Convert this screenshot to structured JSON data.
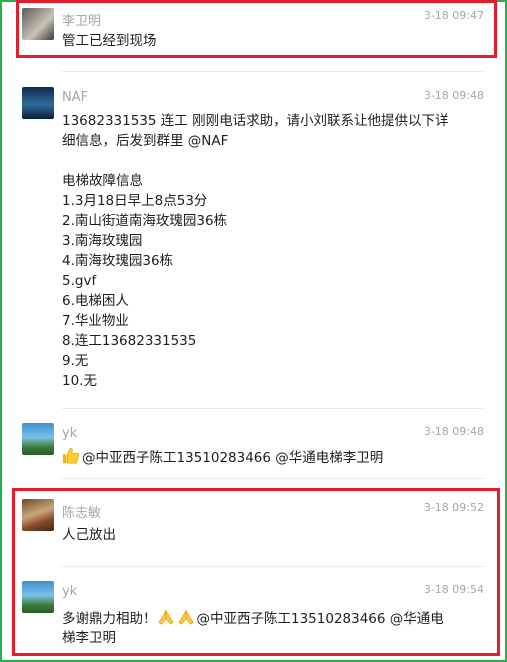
{
  "messages": [
    {
      "name": "李卫明",
      "time": "3-18 09:47",
      "lines": [
        "管工已经到现场"
      ]
    },
    {
      "name": "NAF",
      "time": "3-18 09:48",
      "lines": [
        "13682331535 连工 刚刚电话求助，请小刘联系让他提供以下详",
        "细信息，后发到群里 @NAF",
        "",
        "电梯故障信息",
        "1.3月18日早上8点53分",
        "2.南山街道南海玫瑰园36栋",
        "3.南海玫瑰园",
        "4.南海玫瑰园36栋",
        "5.gvf",
        "6.电梯困人",
        "7.华业物业",
        "8.连工13682331535",
        "9.无",
        "10.无"
      ]
    },
    {
      "name": "yk",
      "time": "3-18 09:48",
      "lines": [
        "@中亚西子陈工13510283466 @华通电梯李卫明"
      ],
      "emoji": "thumbs-up-icon"
    },
    {
      "name": "陈志敏",
      "time": "3-18 09:52",
      "lines": [
        "人己放出"
      ]
    },
    {
      "name": "yk",
      "time": "3-18 09:54",
      "lines": [
        "多谢鼎力相助！",
        "@中亚西子陈工13510283466 @华通电",
        "梯李卫明"
      ],
      "emoji": "praying-hands-icon"
    }
  ],
  "colors": {
    "frame": "#22b04a",
    "highlight": "#e31d2a",
    "meta_text": "#a6a6a6",
    "body_text": "#1e1e1e"
  }
}
